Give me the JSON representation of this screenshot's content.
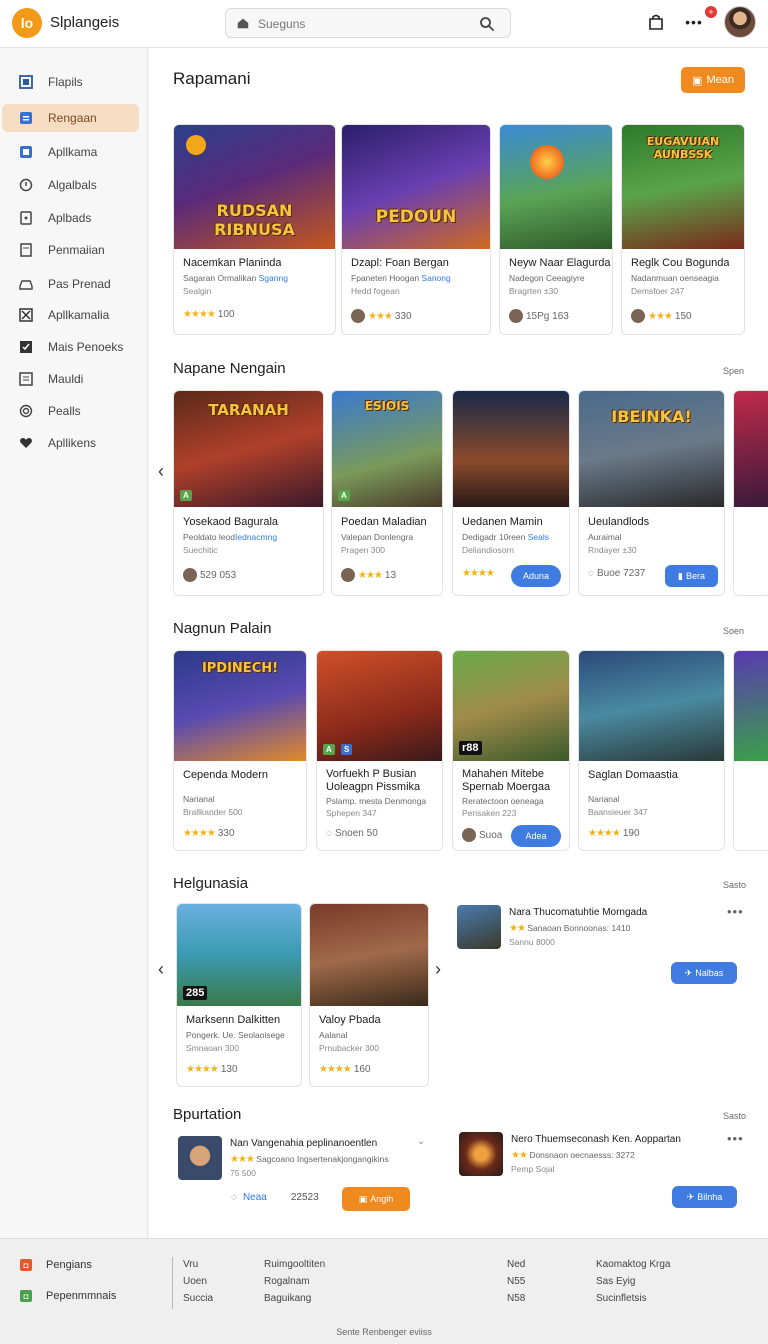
{
  "app": {
    "logo_text": "lo",
    "title": "Slplangeis"
  },
  "search": {
    "placeholder": "Sueguns"
  },
  "header": {
    "notification_count": "+"
  },
  "sidebar": {
    "items": [
      {
        "label": "Flapils",
        "icon": "grid-icon"
      },
      {
        "label": "Rengaan",
        "icon": "home-icon",
        "active": true
      },
      {
        "label": "Apllkama",
        "icon": "apps-icon"
      },
      {
        "label": "Algalbals",
        "icon": "compass-icon"
      },
      {
        "label": "Aplbads",
        "icon": "tablet-icon"
      },
      {
        "label": "Penmaiian",
        "icon": "page-icon"
      },
      {
        "label": "Pas Prenad",
        "icon": "car-icon"
      },
      {
        "label": "Apllkamalia",
        "icon": "cross-icon"
      },
      {
        "label": "Mais Penoeks",
        "icon": "check-icon"
      },
      {
        "label": "Mauldi",
        "icon": "list-icon"
      },
      {
        "label": "Pealls",
        "icon": "target-icon"
      },
      {
        "label": "Apllikens",
        "icon": "heart-icon"
      }
    ]
  },
  "section1": {
    "title": "Rapamani",
    "button": "Mean",
    "cards": [
      {
        "thumb_title": "RUDSAN RIBNUSA",
        "title": "Nacemkan Planinda",
        "sub1": "Sagaran Ormalikan",
        "sub1_link": "Sganng",
        "sub2": "Sealgin",
        "stars": "★★★★",
        "count": "100"
      },
      {
        "thumb_title": "PEDOUN",
        "title": "Dzapl: Foan Bergan",
        "sub1": "Fpaneteri Hoogan",
        "sub1_link": "Sanong",
        "sub2": "Hedd fogean",
        "stars": "★★★",
        "count": "330"
      },
      {
        "thumb_title": "",
        "title": "Neyw Naar Elagurda",
        "sub1": "Nadegon Ceeagiyre",
        "sub1_link": "",
        "sub2": "Bragrten ±30",
        "stars": "",
        "count": "15Pg 163"
      },
      {
        "thumb_title": "EUGAVUIAN AUNBSSK",
        "title": "Reglk Cou Bogunda",
        "sub1": "Nadanmuan oenseagia",
        "sub1_link": "",
        "sub2": "Demsfoer 247",
        "stars": "★★★",
        "count": "150"
      }
    ]
  },
  "section2": {
    "title": "Napane Nengain",
    "link": "Spen",
    "cards": [
      {
        "thumb_title": "TARANAH",
        "title": "Yosekaod Bagurala",
        "sub1": "Peoldato leod",
        "sub1_link": "Iednacmng",
        "sub2": "Suechitic",
        "stars": "",
        "count": "529 053"
      },
      {
        "thumb_title": "ESIOIS",
        "title": "Poedan Maladian",
        "sub1": "Valepan Donlengra",
        "sub1_link": "",
        "sub2": "Pragen 300",
        "stars": "★★★",
        "count": "13"
      },
      {
        "thumb_title": "",
        "title": "Uedanen Mamin",
        "sub1": "Dedigadr 10reen",
        "sub1_link": "Seals",
        "sub2": "Deliandiosorn",
        "stars": "★★★★",
        "count": "",
        "button": "Aduna"
      },
      {
        "thumb_title": "IBEINKA!",
        "title": "Ueulandlods",
        "sub1": "Auraimal",
        "sub1_link": "",
        "sub2": "Rndayer ±30",
        "stars": "",
        "count": "Buoe 7237",
        "button": "Bera"
      }
    ]
  },
  "section3": {
    "title": "Nagnun Palain",
    "link": "Soen",
    "cards": [
      {
        "thumb_title": "IPDINECH!",
        "title": "Cependa Modern",
        "title2": "",
        "sub1": "Narianal",
        "sub2": "Brallkander 500",
        "stars": "★★★★",
        "count": "330"
      },
      {
        "thumb_title": "",
        "title": "Vorfuekh P Busian",
        "title2": "Uoleagpn Pissmika",
        "sub1": "Pslamp. mesta Denmonga",
        "sub2": "Sphepen 347",
        "stars": "",
        "count": "Snoen 50"
      },
      {
        "thumb_title": "",
        "title": "Mahahen Mitebe",
        "title2": "Spernab Moergaa",
        "sub1": "Reratectoon oeneaga",
        "sub2": "Perisaken 223",
        "stars": "",
        "count": "Suoa",
        "button": "Adea"
      },
      {
        "thumb_title": "",
        "title": "Saglan Domaastia",
        "title2": "",
        "sub1": "Narianal",
        "sub2": "Baansieuer 347",
        "stars": "★★★★",
        "count": "190"
      }
    ]
  },
  "section4": {
    "title": "Helgunasia",
    "link": "Sasto",
    "cards": [
      {
        "thumb_badge": "285",
        "title": "Marksenn Dalkitten",
        "sub1": "Pongerk. Ue. Seolaoisege",
        "sub2": "Smnaoan 300",
        "stars": "★★★★",
        "count": "130"
      },
      {
        "thumb_badge": "",
        "title": "Valoy Pbada",
        "sub1": "Aalanal",
        "sub2": "Prnubacker 300",
        "stars": "★★★★",
        "count": "160"
      }
    ],
    "list": {
      "line1": "Nara Thucomatuhtie Morngada",
      "line2": "Sanaoan Bonnoonas: 1410",
      "line3": "Sannu 8000",
      "button": "Nalbas"
    }
  },
  "section5": {
    "title": "Bpurtation",
    "link": "Sasto",
    "left": {
      "line1": "Nan Vangenahia peplinanoentlen",
      "line2": "Sagcoano Ingsertenakjongangikins",
      "line3": "75 500",
      "tag": "Neaa",
      "count": "22523",
      "button": "Angih"
    },
    "right": {
      "line1": "Nero Thuemseconash Ken. Aoppartan",
      "line2": "Donsnaon oecnaesss: 3272",
      "line3": "Pemp Sojal",
      "button": "Bilnha"
    }
  },
  "footer": {
    "nav": [
      {
        "label": "Pengians",
        "color": "#e05a2b"
      },
      {
        "label": "Pepenmmnais",
        "color": "#4aa14c"
      }
    ],
    "col1": [
      "Vru",
      "Uoen",
      "Succia"
    ],
    "col2": [
      "Ruimgooltiten",
      "Rogalnam",
      "Baguikang"
    ],
    "col3": [
      "Ned",
      "N55",
      "N58"
    ],
    "col4": [
      "Kaomaktog Krga",
      "Sas Eyig",
      "Sucinfletsis"
    ],
    "bottom": "Sente Renbenger eviiss"
  }
}
